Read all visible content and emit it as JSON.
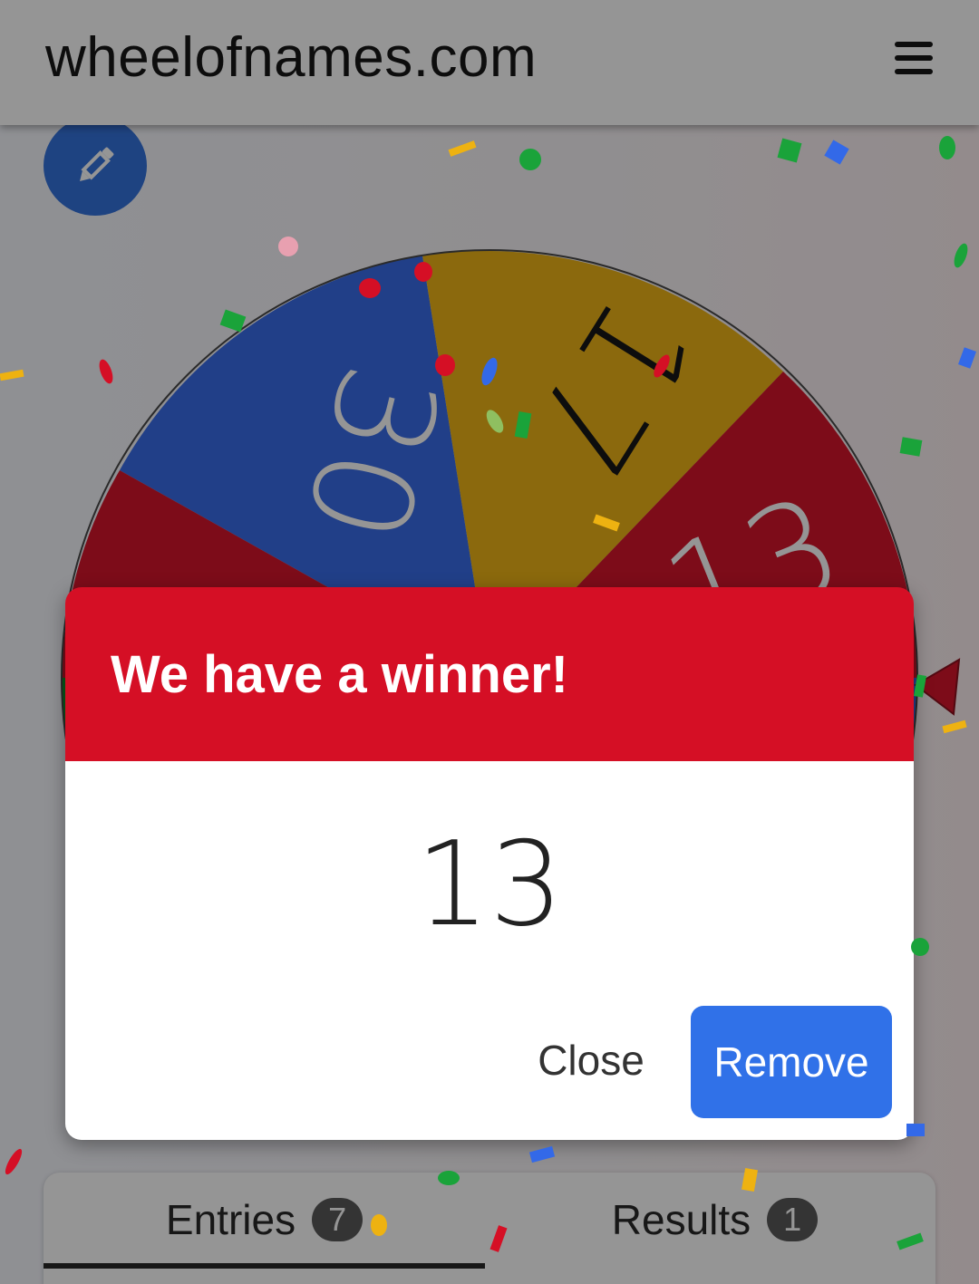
{
  "header": {
    "site_title": "wheelofnames.com",
    "menu_icon": "hamburger-menu-icon"
  },
  "toolbar": {
    "edit_icon": "pencil-icon"
  },
  "wheel": {
    "segments": [
      {
        "label": "30",
        "color": "#3369e8"
      },
      {
        "label": "17",
        "color": "#eeb211"
      },
      {
        "label": "13",
        "color": "#d50f25"
      }
    ],
    "pointer_color": "#d50f25"
  },
  "dialog": {
    "title": "We have a winner!",
    "winner": "13",
    "close_label": "Close",
    "remove_label": "Remove",
    "header_color": "#d50f25",
    "remove_color": "#3071e8"
  },
  "tabs": {
    "entries_label": "Entries",
    "entries_count": "7",
    "results_label": "Results",
    "results_count": "1"
  }
}
